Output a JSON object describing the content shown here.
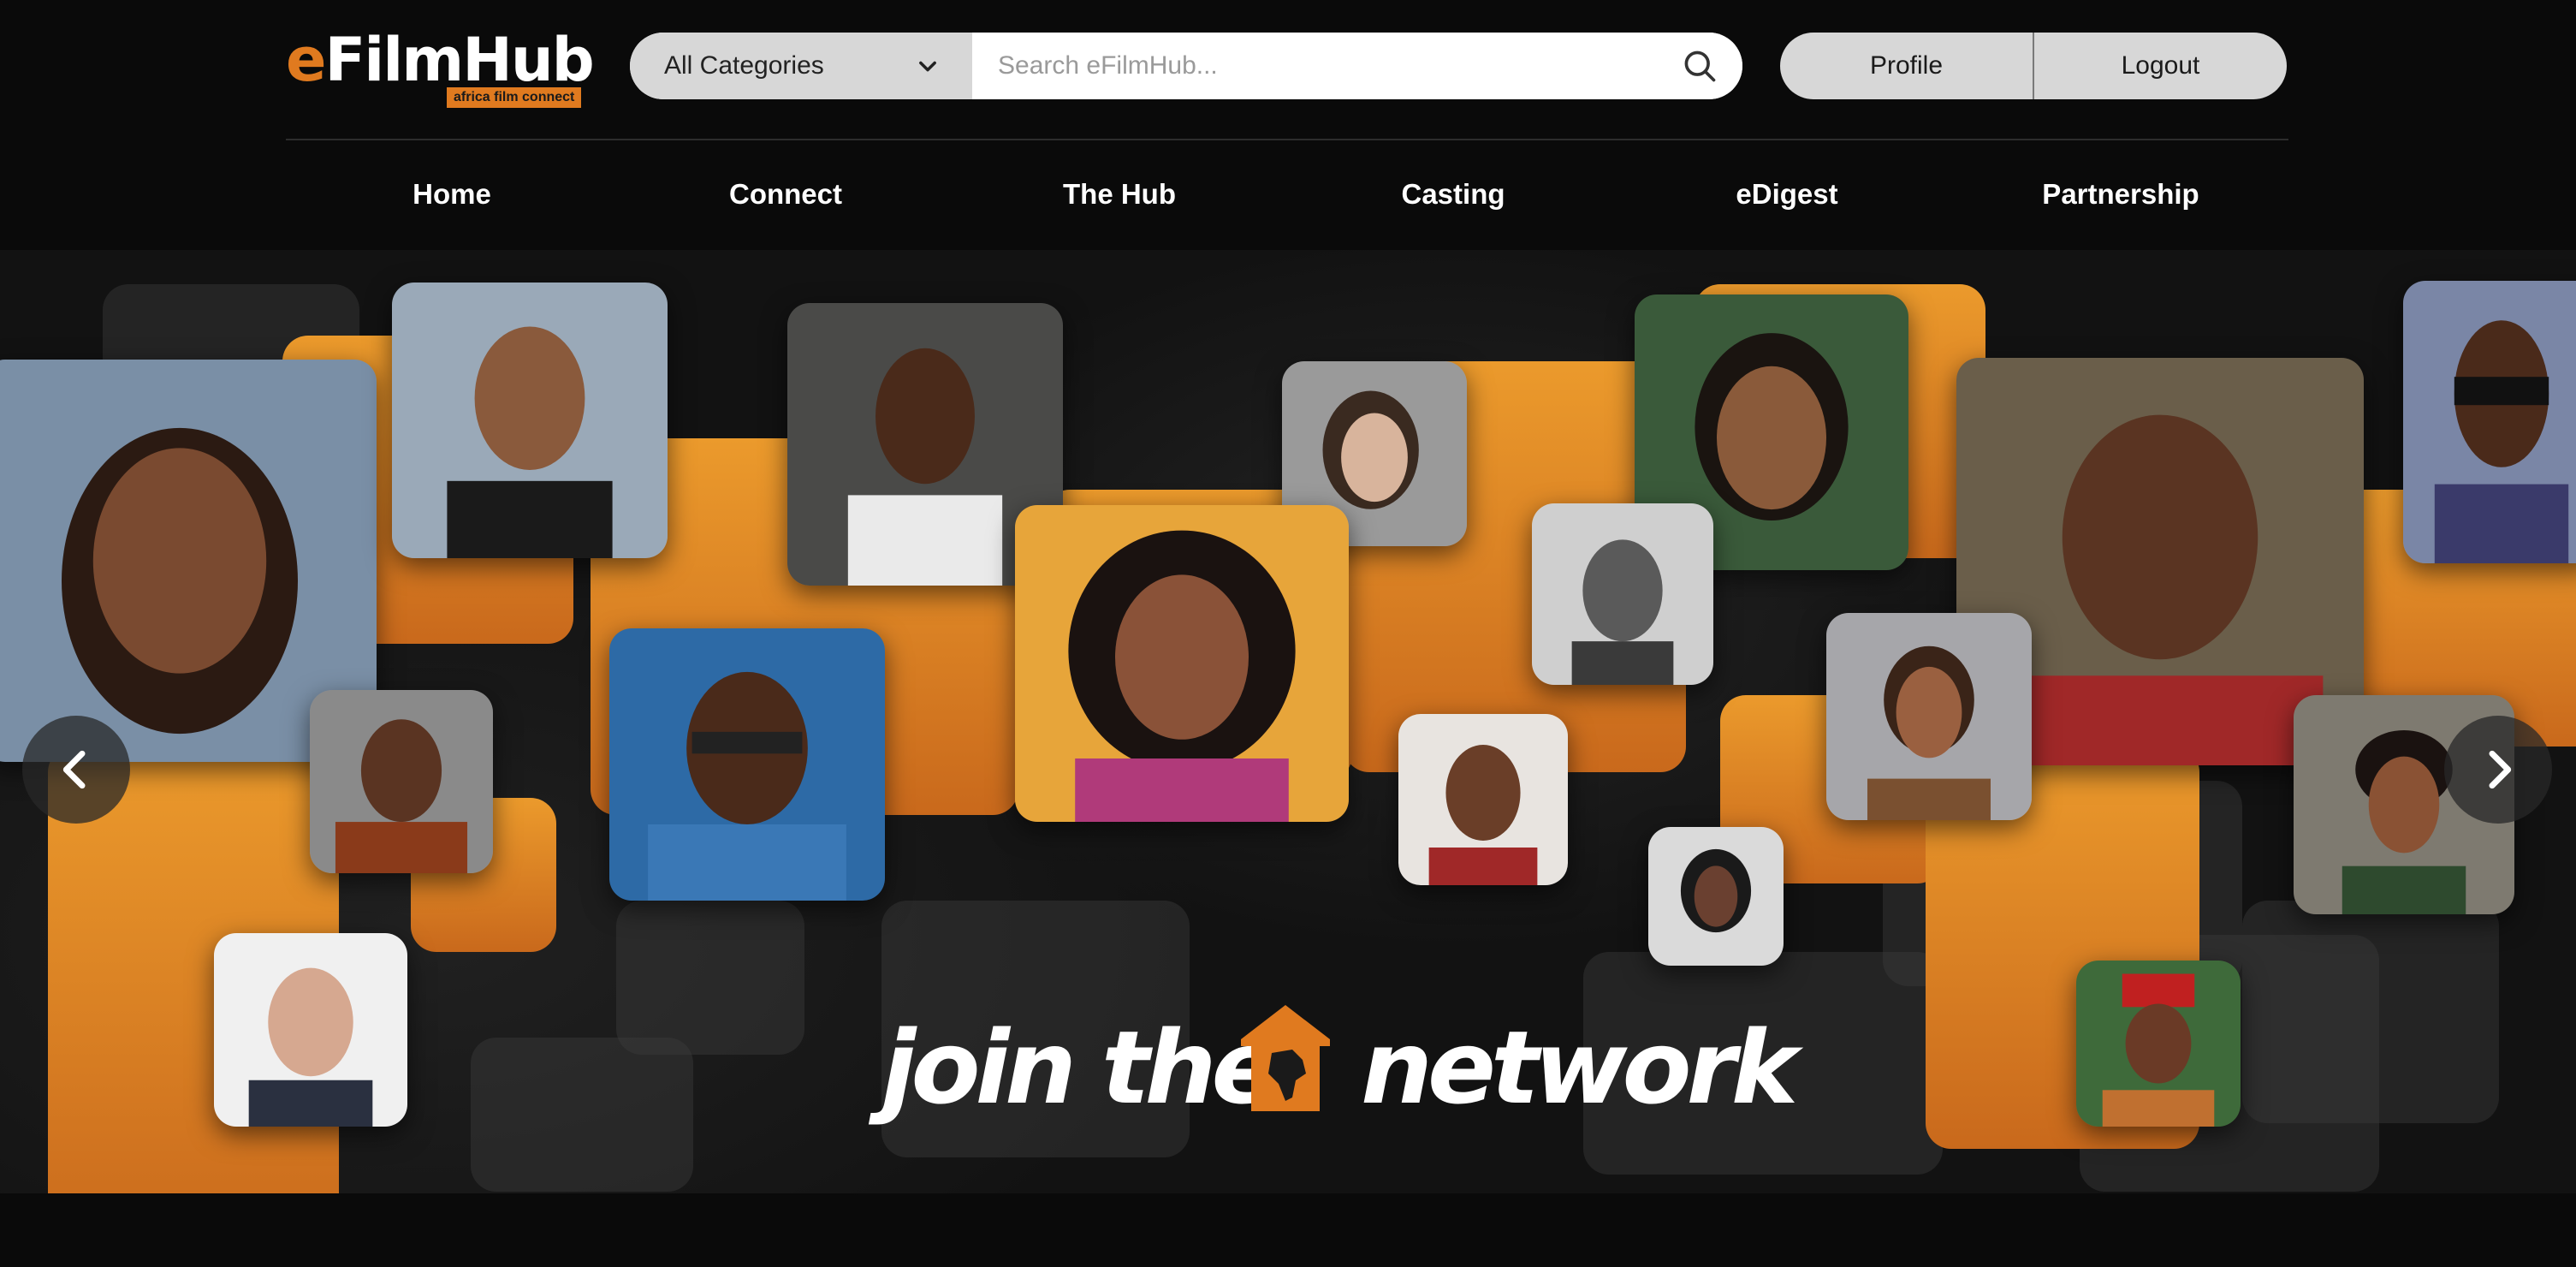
{
  "brand": {
    "logo_text": "eFilmHub",
    "logo_e": "e",
    "logo_rest": "FilmHub",
    "tagline": "africa film connect",
    "accent": "#e07a1f"
  },
  "search": {
    "category_label": "All Categories",
    "placeholder": "Search eFilmHub..."
  },
  "auth": {
    "profile_label": "Profile",
    "logout_label": "Logout"
  },
  "nav": {
    "items": [
      {
        "label": "Home"
      },
      {
        "label": "Connect"
      },
      {
        "label": "The Hub"
      },
      {
        "label": "Casting"
      },
      {
        "label": "eDigest"
      },
      {
        "label": "Partnership"
      }
    ]
  },
  "hero": {
    "banner_text_a": "join the",
    "banner_text_b": "network",
    "banner_icon": "hub-house-africa-icon",
    "prev_icon": "chevron-left-icon",
    "next_icon": "chevron-right-icon"
  },
  "colors": {
    "background": "#0a0a0a",
    "pill_grey": "#d7d7d7",
    "orange_tile": "#e8942a"
  }
}
